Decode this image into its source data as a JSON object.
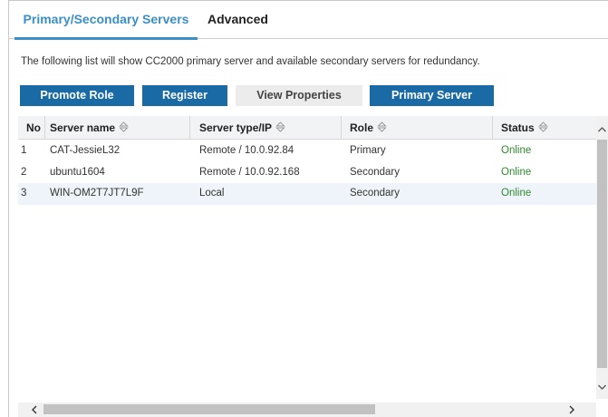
{
  "tabs": [
    {
      "label": "Primary/Secondary Servers",
      "active": true
    },
    {
      "label": "Advanced",
      "active": false
    }
  ],
  "description": "The following list will show CC2000 primary server and available secondary servers for redundancy.",
  "toolbar": {
    "promote_role": "Promote Role",
    "register": "Register",
    "view_properties": "View Properties",
    "primary_server": "Primary Server"
  },
  "table": {
    "columns": [
      "No",
      "Server name",
      "Server type/IP",
      "Role",
      "Status"
    ],
    "rows": [
      {
        "no": "1",
        "name": "CAT-JessieL32",
        "type_ip": "Remote / 10.0.92.84",
        "role": "Primary",
        "status": "Online"
      },
      {
        "no": "2",
        "name": "ubuntu1604",
        "type_ip": "Remote / 10.0.92.168",
        "role": "Secondary",
        "status": "Online"
      },
      {
        "no": "3",
        "name": "WIN-OM2T7JT7L9F",
        "type_ip": "Local",
        "role": "Secondary",
        "status": "Online"
      }
    ]
  },
  "colors": {
    "accent": "#3a8fc7",
    "button_primary": "#1a6aa6",
    "button_disabled": "#ececec",
    "status_online": "#2f8a2f",
    "row_alt": "#eef4fa"
  },
  "icons": {
    "sort": "sort-updown-icon",
    "scroll_up": "chevron-up-icon",
    "scroll_down": "chevron-down-icon",
    "scroll_left": "chevron-left-icon",
    "scroll_right": "chevron-right-icon"
  }
}
